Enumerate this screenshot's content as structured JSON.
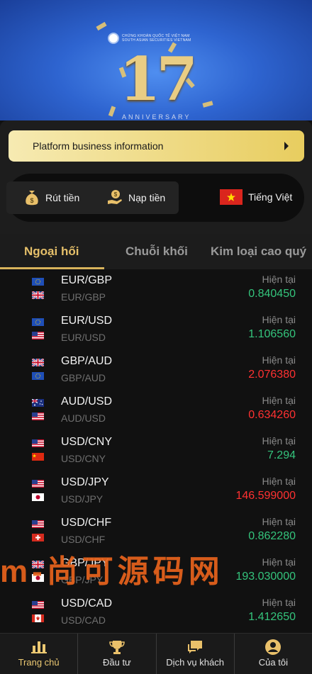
{
  "banner": {
    "brand_line1": "CHỨNG KHOÁN QUỐC TẾ VIỆT NAM",
    "brand_line2": "SOUTH ASIAN SECURITIES VIETNAM",
    "anniversary_number": "17",
    "anniversary_text": "ANNIVERSARY"
  },
  "notice": {
    "label": "Platform business information"
  },
  "actions": {
    "withdraw": "Rút tiền",
    "deposit": "Nạp tiền",
    "language": "Tiếng Việt"
  },
  "tabs": [
    "Ngoại hối",
    "Chuỗi khối",
    "Kim loại cao quý"
  ],
  "current_label": "Hiện tại",
  "colors": {
    "gold": "#e6c06a",
    "up": "#34c47c",
    "down": "#ff3131"
  },
  "quotes": [
    {
      "pair": "EUR/GBP",
      "sub": "EUR/GBP",
      "price": "0.840450",
      "trend": "up",
      "flags": [
        "EU",
        "GB"
      ]
    },
    {
      "pair": "EUR/USD",
      "sub": "EUR/USD",
      "price": "1.106560",
      "trend": "up",
      "flags": [
        "EU",
        "US"
      ]
    },
    {
      "pair": "GBP/AUD",
      "sub": "GBP/AUD",
      "price": "2.076380",
      "trend": "down",
      "flags": [
        "GB",
        "EU"
      ]
    },
    {
      "pair": "AUD/USD",
      "sub": "AUD/USD",
      "price": "0.634260",
      "trend": "down",
      "flags": [
        "AU",
        "US"
      ]
    },
    {
      "pair": "USD/CNY",
      "sub": "USD/CNY",
      "price": "7.294",
      "trend": "up",
      "flags": [
        "US",
        "CN"
      ]
    },
    {
      "pair": "USD/JPY",
      "sub": "USD/JPY",
      "price": "146.599000",
      "trend": "down",
      "flags": [
        "US",
        "JP"
      ]
    },
    {
      "pair": "USD/CHF",
      "sub": "USD/CHF",
      "price": "0.862280",
      "trend": "up",
      "flags": [
        "US",
        "CH"
      ]
    },
    {
      "pair": "GBP/JPY",
      "sub": "GBP/JPY",
      "price": "193.030000",
      "trend": "up",
      "flags": [
        "GB",
        "JP"
      ]
    },
    {
      "pair": "USD/CAD",
      "sub": "USD/CAD",
      "price": "1.412650",
      "trend": "up",
      "flags": [
        "US",
        "CA"
      ]
    }
  ],
  "watermark": "m-尚可源码网",
  "nav": [
    {
      "label": "Trang chủ",
      "icon": "bar-chart-icon",
      "active": true
    },
    {
      "label": "Đầu tư",
      "icon": "trophy-icon",
      "active": false
    },
    {
      "label": "Dịch vụ khách",
      "icon": "chat-icon",
      "active": false
    },
    {
      "label": "Của tôi",
      "icon": "user-icon",
      "active": false
    }
  ]
}
